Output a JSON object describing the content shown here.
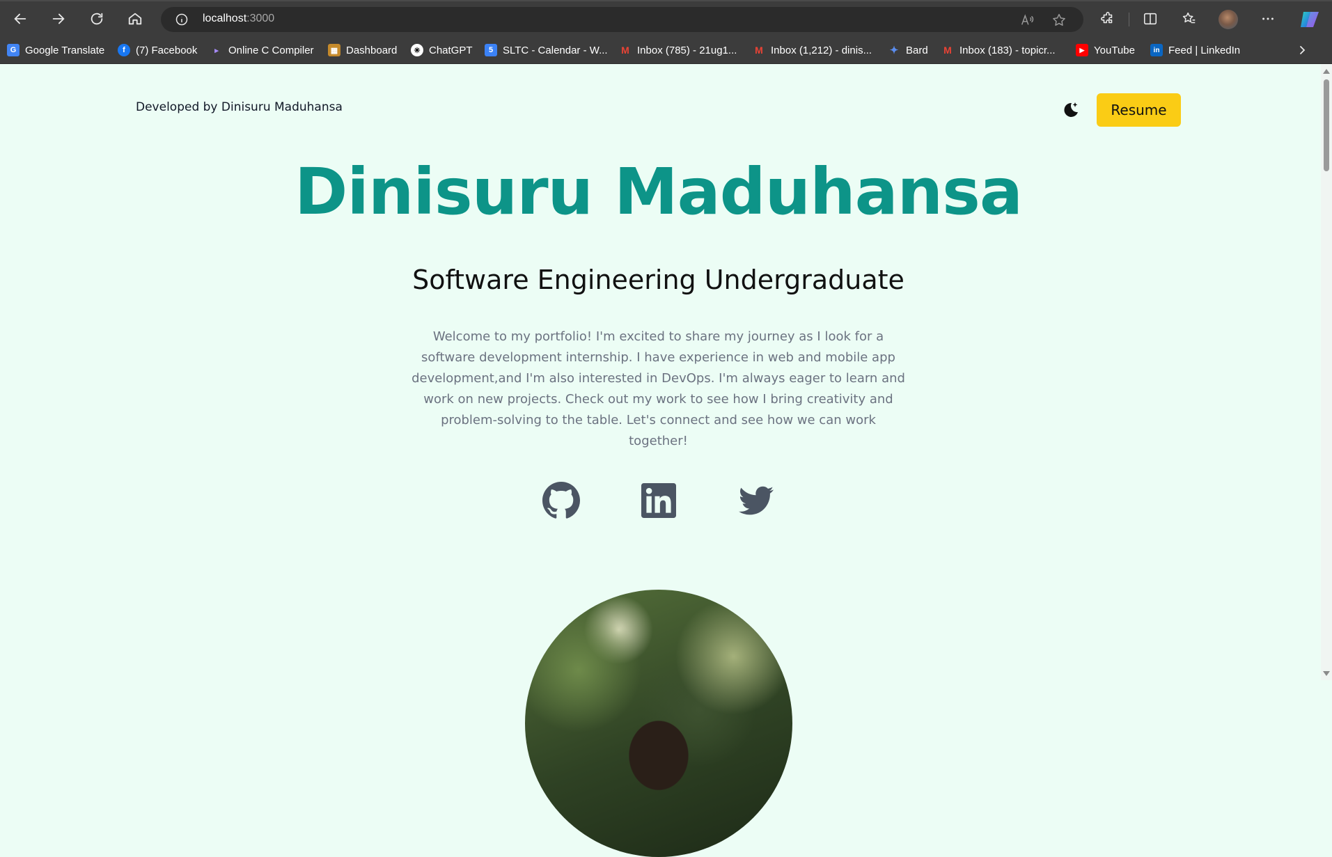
{
  "browser": {
    "url_host": "localhost",
    "url_port": ":3000",
    "bookmarks": [
      {
        "label": "Google Translate",
        "icon": "google-translate-icon",
        "color": "#4285f4"
      },
      {
        "label": "(7) Facebook",
        "icon": "facebook-icon",
        "color": "#1877f2"
      },
      {
        "label": "Online C Compiler",
        "icon": "compiler-icon",
        "color": "#7c3aed"
      },
      {
        "label": "Dashboard",
        "icon": "dashboard-icon",
        "color": "#c58a2b"
      },
      {
        "label": "ChatGPT",
        "icon": "chatgpt-icon",
        "color": "#ffffff"
      },
      {
        "label": "SLTC - Calendar - W...",
        "icon": "calendar-icon",
        "color": "#3b82f6"
      },
      {
        "label": "Inbox (785) - 21ug1...",
        "icon": "gmail-icon",
        "color": "#ea4335"
      },
      {
        "label": "Inbox (1,212) - dinis...",
        "icon": "gmail-icon",
        "color": "#ea4335"
      },
      {
        "label": "Bard",
        "icon": "bard-icon",
        "color": "#5b8def"
      },
      {
        "label": "Inbox (183) - topicr...",
        "icon": "gmail-icon",
        "color": "#ea4335"
      },
      {
        "label": "YouTube",
        "icon": "youtube-icon",
        "color": "#ff0000"
      },
      {
        "label": "Feed | LinkedIn",
        "icon": "linkedin-icon",
        "color": "#0a66c2"
      }
    ]
  },
  "page": {
    "developer_credit": "Developed by Dinisuru Maduhansa",
    "resume_label": "Resume",
    "name": "Dinisuru Maduhansa",
    "role": "Software Engineering Undergraduate",
    "intro": "Welcome to my portfolio! I'm excited to share my journey as I look for a software development internship. I have experience in web and mobile app development,and I'm also interested in DevOps. I'm always eager to learn and work on new projects. Check out my work to see how I bring creativity and problem-solving to the table. Let's connect and see how we can work together!",
    "social": [
      "github-icon",
      "linkedin-icon",
      "twitter-icon"
    ],
    "colors": {
      "accent": "#0d9488",
      "button": "#facc15",
      "background": "#ecfdf5",
      "muted_text": "#6b7280",
      "social_icon": "#4b5563"
    }
  }
}
